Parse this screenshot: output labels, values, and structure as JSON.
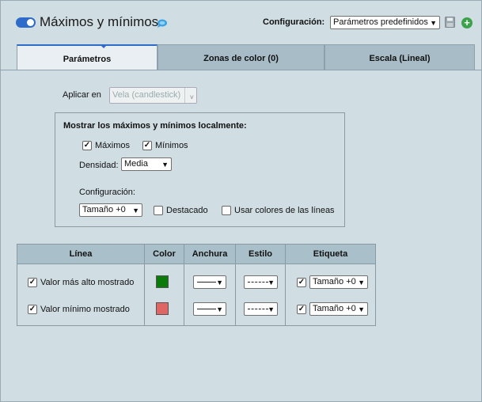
{
  "header": {
    "title": "Máximos y mínimos",
    "config_label": "Configuración:",
    "config_value": "Parámetros predefinidos"
  },
  "tabs": [
    {
      "label": "Parámetros",
      "active": true
    },
    {
      "label": "Zonas de color (0)",
      "active": false
    },
    {
      "label": "Escala (Lineal)",
      "active": false
    }
  ],
  "apply": {
    "label": "Aplicar en",
    "value": "Vela (candlestick)"
  },
  "local": {
    "title": "Mostrar los máximos y mínimos localmente:",
    "maximos": {
      "label": "Máximos",
      "checked": true
    },
    "minimos": {
      "label": "Mínimos",
      "checked": true
    },
    "density_label": "Densidad:",
    "density_value": "Media",
    "config_label": "Configuración:",
    "size_value": "Tamaño +0",
    "destacado": {
      "label": "Destacado",
      "checked": false
    },
    "line_colors": {
      "label": "Usar colores de las líneas",
      "checked": false
    }
  },
  "table": {
    "headers": [
      "Línea",
      "Color",
      "Anchura",
      "Estilo",
      "Etiqueta"
    ],
    "rows": [
      {
        "label": "Valor más alto mostrado",
        "checked": true,
        "color": "#0a7a0a",
        "label_checked": true,
        "label_size": "Tamaño +0"
      },
      {
        "label": "Valor mínimo mostrado",
        "checked": true,
        "color": "#e06666",
        "label_checked": true,
        "label_size": "Tamaño +0"
      }
    ]
  },
  "icons": {
    "toggle": "toggle-icon",
    "chat": "chat-bubble-icon",
    "save": "save-icon",
    "add": "add-icon"
  },
  "colors": {
    "accent": "#2f6bc9",
    "background": "#d0dde3",
    "tab": "#a7bcc6",
    "add": "#3aa34a"
  }
}
